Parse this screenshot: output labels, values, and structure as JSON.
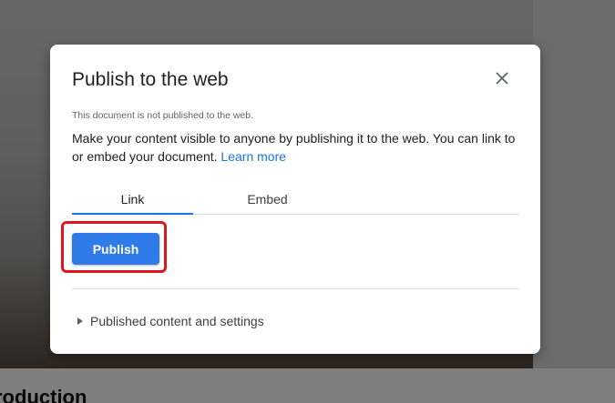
{
  "background": {
    "heading": "roduction"
  },
  "dialog": {
    "title": "Publish to the web",
    "close_icon": "close-icon",
    "status": "This document is not published to the web.",
    "description": "Make your content visible to anyone by publishing it to the web. You can link to or embed your document. ",
    "learn_more": "Learn more",
    "tabs": [
      {
        "label": "Link",
        "selected": true
      },
      {
        "label": "Embed",
        "selected": false
      }
    ],
    "publish_label": "Publish",
    "expander_label": "Published content and settings",
    "expander_icon": "triangle-right-icon",
    "accent_color": "#1a73e8",
    "highlight_color": "#e0141e"
  }
}
